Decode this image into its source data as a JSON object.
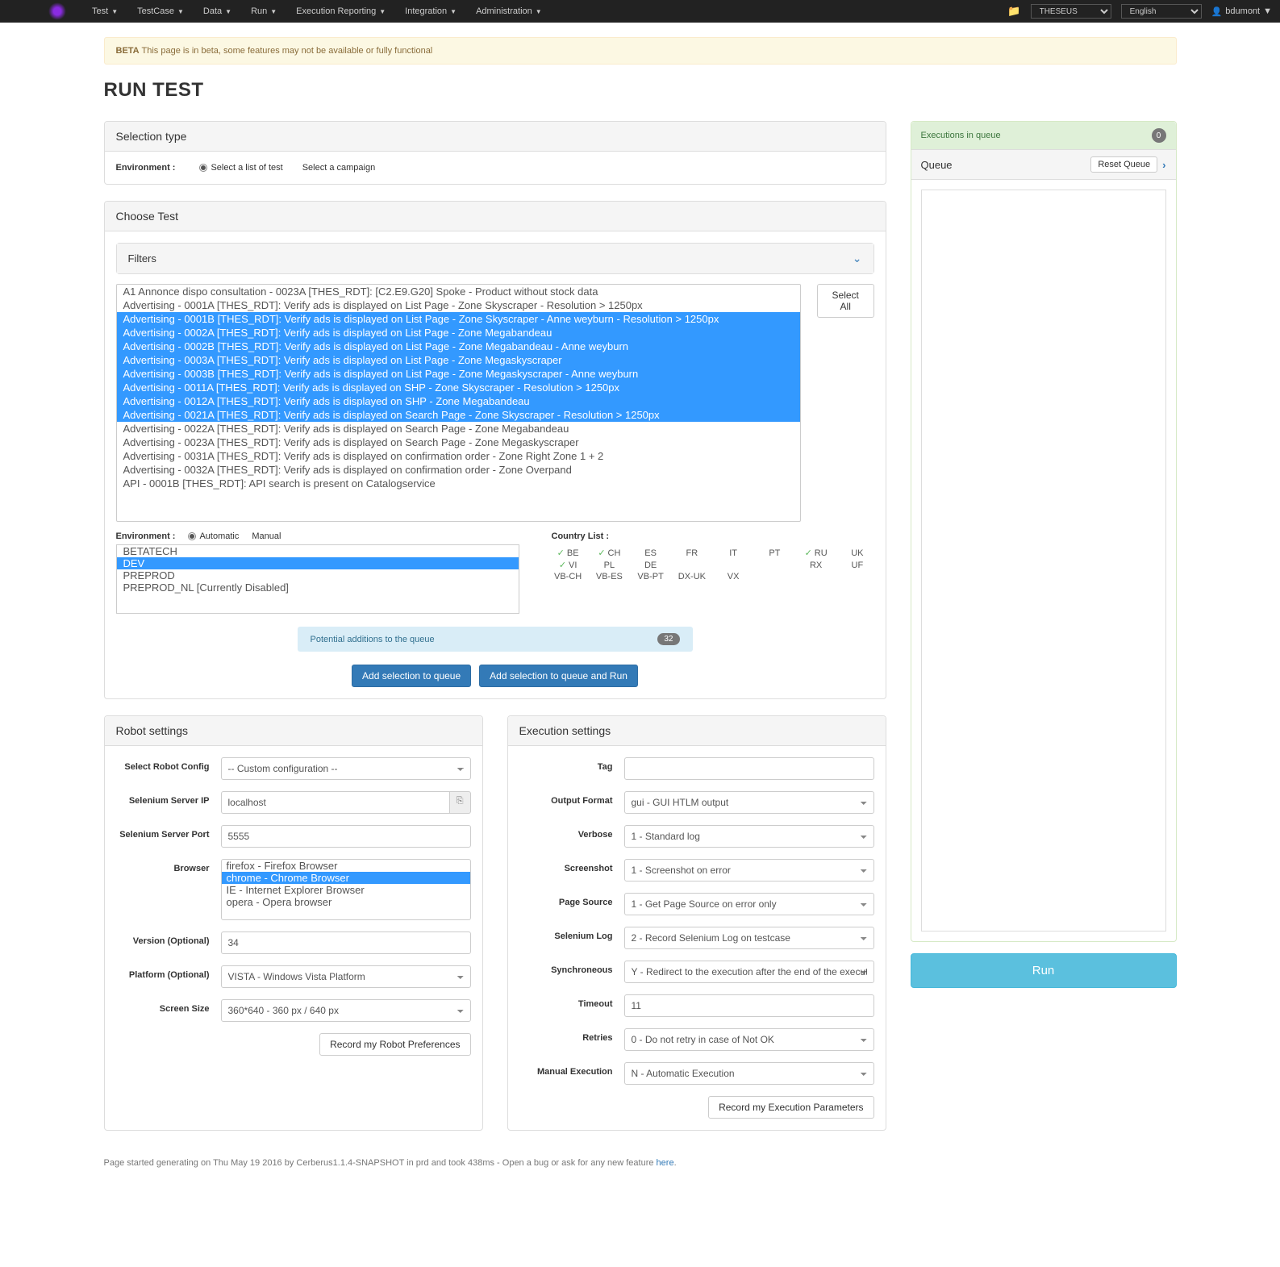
{
  "nav": {
    "items": [
      "Test",
      "TestCase",
      "Data",
      "Run",
      "Execution Reporting",
      "Integration",
      "Administration"
    ],
    "system_select": "THESEUS",
    "lang_select": "English",
    "user": "bdumont"
  },
  "beta": {
    "label": "BETA",
    "text": "This page is in beta, some features may not be available or fully functional"
  },
  "page_title": "RUN TEST",
  "selection_type": {
    "header": "Selection type",
    "env_label": "Environment :",
    "opt1": "Select a list of test",
    "opt2": "Select a campaign"
  },
  "choose_test": {
    "header": "Choose Test",
    "filters": "Filters",
    "select_all": "Select All",
    "tests": [
      {
        "t": "A1 Annonce dispo consultation - 0023A [THES_RDT]: [C2.E9.G20] Spoke - Product without stock data",
        "s": false
      },
      {
        "t": "Advertising - 0001A [THES_RDT]: Verify ads is displayed on List Page - Zone Skyscraper - Resolution > 1250px",
        "s": false
      },
      {
        "t": "Advertising - 0001B [THES_RDT]: Verify ads is displayed on List Page - Zone Skyscraper - Anne weyburn - Resolution > 1250px",
        "s": true
      },
      {
        "t": "Advertising - 0002A [THES_RDT]: Verify ads is displayed on List Page - Zone Megabandeau",
        "s": true
      },
      {
        "t": "Advertising - 0002B [THES_RDT]: Verify ads is displayed on List Page - Zone Megabandeau - Anne weyburn",
        "s": true
      },
      {
        "t": "Advertising - 0003A [THES_RDT]: Verify ads is displayed on List Page - Zone Megaskyscraper",
        "s": true
      },
      {
        "t": "Advertising - 0003B [THES_RDT]: Verify ads is displayed on List Page - Zone Megaskyscraper - Anne weyburn",
        "s": true
      },
      {
        "t": "Advertising - 0011A [THES_RDT]: Verify ads is displayed on SHP - Zone Skyscraper - Resolution > 1250px",
        "s": true
      },
      {
        "t": "Advertising - 0012A [THES_RDT]: Verify ads is displayed on SHP - Zone Megabandeau",
        "s": true
      },
      {
        "t": "Advertising - 0021A [THES_RDT]: Verify ads is displayed on Search Page - Zone Skyscraper - Resolution > 1250px",
        "s": true
      },
      {
        "t": "Advertising - 0022A [THES_RDT]: Verify ads is displayed on Search Page - Zone Megabandeau",
        "s": false
      },
      {
        "t": "Advertising - 0023A [THES_RDT]: Verify ads is displayed on Search Page - Zone Megaskyscraper",
        "s": false
      },
      {
        "t": "Advertising - 0031A [THES_RDT]: Verify ads is displayed on confirmation order - Zone Right Zone 1 + 2",
        "s": false
      },
      {
        "t": "Advertising - 0032A [THES_RDT]: Verify ads is displayed on confirmation order - Zone Overpand",
        "s": false
      },
      {
        "t": "API - 0001B [THES_RDT]: API search is present on Catalogservice",
        "s": false
      }
    ],
    "env_label2": "Environment :",
    "auto": "Automatic",
    "manual": "Manual",
    "envs": [
      {
        "t": "BETATECH",
        "s": false
      },
      {
        "t": "DEV",
        "s": true
      },
      {
        "t": "PREPROD",
        "s": false
      },
      {
        "t": "PREPROD_NL [Currently Disabled]",
        "s": false
      }
    ],
    "country_label": "Country List :",
    "countries_r1": [
      {
        "c": "BE",
        "k": true
      },
      {
        "c": "CH",
        "k": true
      },
      {
        "c": "ES",
        "k": false
      },
      {
        "c": "FR",
        "k": false
      },
      {
        "c": "IT",
        "k": false
      },
      {
        "c": "PT",
        "k": false
      },
      {
        "c": "RU",
        "k": true
      },
      {
        "c": "UK",
        "k": false
      }
    ],
    "countries_r1b": [
      {
        "c": "VI",
        "k": true
      },
      {
        "c": "PL",
        "k": false
      },
      {
        "c": "DE",
        "k": false
      }
    ],
    "countries_r2": [
      "RX",
      "UF",
      "VB-CH",
      "VB-ES",
      "VB-PT",
      "DX-UK",
      "VX"
    ],
    "potential_label": "Potential additions to the queue",
    "potential_count": "32",
    "btn_add": "Add selection to queue",
    "btn_add_run": "Add selection to queue and Run"
  },
  "robot": {
    "header": "Robot settings",
    "config_label": "Select Robot Config",
    "config_val": "-- Custom configuration --",
    "ip_label": "Selenium Server IP",
    "ip_val": "localhost",
    "port_label": "Selenium Server Port",
    "port_val": "5555",
    "browser_label": "Browser",
    "browsers": [
      {
        "t": "firefox - Firefox Browser",
        "s": false
      },
      {
        "t": "chrome - Chrome Browser",
        "s": true
      },
      {
        "t": "IE - Internet Explorer Browser",
        "s": false
      },
      {
        "t": "opera - Opera browser",
        "s": false
      }
    ],
    "version_label": "Version (Optional)",
    "version_val": "34",
    "platform_label": "Platform (Optional)",
    "platform_val": "VISTA - Windows Vista Platform",
    "screen_label": "Screen Size",
    "screen_val": "360*640 - 360 px / 640 px",
    "record_btn": "Record my Robot Preferences"
  },
  "exec": {
    "header": "Execution settings",
    "tag_label": "Tag",
    "tag_val": "",
    "output_label": "Output Format",
    "output_val": "gui - GUI HTLM output",
    "verbose_label": "Verbose",
    "verbose_val": "1 - Standard log",
    "screenshot_label": "Screenshot",
    "screenshot_val": "1 - Screenshot on error",
    "pagesrc_label": "Page Source",
    "pagesrc_val": "1 - Get Page Source on error only",
    "selog_label": "Selenium Log",
    "selog_val": "2 - Record Selenium Log on testcase",
    "sync_label": "Synchroneous",
    "sync_val": "Y - Redirect to the execution after the end of the execution",
    "timeout_label": "Timeout",
    "timeout_val": "11",
    "retries_label": "Retries",
    "retries_val": "0 - Do not retry in case of Not OK",
    "manual_label": "Manual Execution",
    "manual_val": "N - Automatic Execution",
    "record_btn": "Record my Execution Parameters"
  },
  "queue": {
    "head1": "Executions in queue",
    "count": "0",
    "head2": "Queue",
    "reset": "Reset Queue",
    "run": "Run"
  },
  "footer": {
    "text": "Page started generating on Thu May 19 2016 by Cerberus1.1.4-SNAPSHOT in prd and took 438ms - Open a bug or ask for any new feature ",
    "link": "here"
  }
}
